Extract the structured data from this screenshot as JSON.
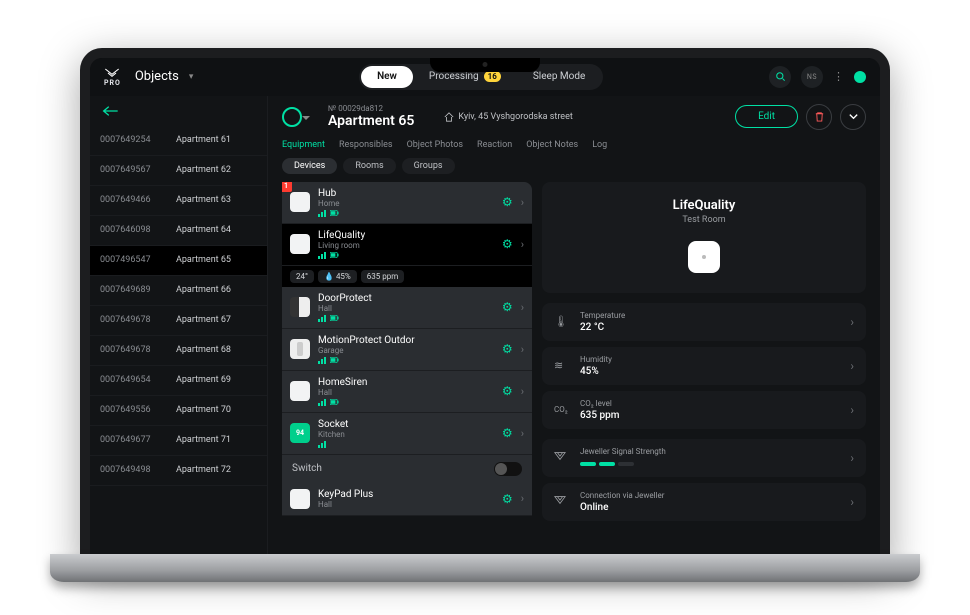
{
  "brand": {
    "name": "PRO"
  },
  "nav": {
    "section": "Objects"
  },
  "modes": {
    "new": "New",
    "processing": "Processing",
    "processing_count": "16",
    "sleep": "Sleep Mode"
  },
  "top": {
    "avatar_initials": "NS"
  },
  "sidebar_items": [
    {
      "id": "0007649254",
      "name": "Apartment 61"
    },
    {
      "id": "0007649567",
      "name": "Apartment 62"
    },
    {
      "id": "0007649466",
      "name": "Apartment 63"
    },
    {
      "id": "0007646098",
      "name": "Apartment 64"
    },
    {
      "id": "0007496547",
      "name": "Apartment 65"
    },
    {
      "id": "0007649689",
      "name": "Apartment 66"
    },
    {
      "id": "0007649678",
      "name": "Apartment 67"
    },
    {
      "id": "0007649678",
      "name": "Apartment 68"
    },
    {
      "id": "0007649654",
      "name": "Apartment 69"
    },
    {
      "id": "0007649556",
      "name": "Apartment 70"
    },
    {
      "id": "0007649677",
      "name": "Apartment 71"
    },
    {
      "id": "0007649498",
      "name": "Apartment 72"
    }
  ],
  "object": {
    "serial_prefix": "№",
    "serial": "00029da812",
    "title": "Apartment 65",
    "address": "Kyiv, 45 Vyshgorodska street",
    "edit_label": "Edit"
  },
  "tabs": {
    "equipment": "Equipment",
    "responsibles": "Responsibles",
    "photos": "Object Photos",
    "reaction": "Reaction",
    "notes": "Object Notes",
    "log": "Log"
  },
  "subtabs": {
    "devices": "Devices",
    "rooms": "Rooms",
    "groups": "Groups"
  },
  "devices": [
    {
      "name": "Hub",
      "room": "Home",
      "alert": "1"
    },
    {
      "name": "LifeQuality",
      "room": "Living room"
    },
    {
      "name": "DoorProtect",
      "room": "Hall"
    },
    {
      "name": "MotionProtect Outdor",
      "room": "Garage"
    },
    {
      "name": "HomeSiren",
      "room": "Hall"
    },
    {
      "name": "Socket",
      "room": "Kitchen"
    },
    {
      "name": "KeyPad Plus",
      "room": "Hall"
    }
  ],
  "env": {
    "temp_short": "24°",
    "hum_short": "45%",
    "co2_short": "635 ppm"
  },
  "switch_label": "Switch",
  "preview": {
    "name": "LifeQuality",
    "room": "Test Room"
  },
  "metrics": {
    "temp_label": "Temperature",
    "temp_val": "22 °C",
    "hum_label": "Humidity",
    "hum_val": "45%",
    "co2_label": "CO₂ level",
    "co2_val": "635 ppm"
  },
  "signal": {
    "label": "Jeweller Signal Strength"
  },
  "conn": {
    "label": "Connection via Jeweller",
    "val": "Online"
  }
}
